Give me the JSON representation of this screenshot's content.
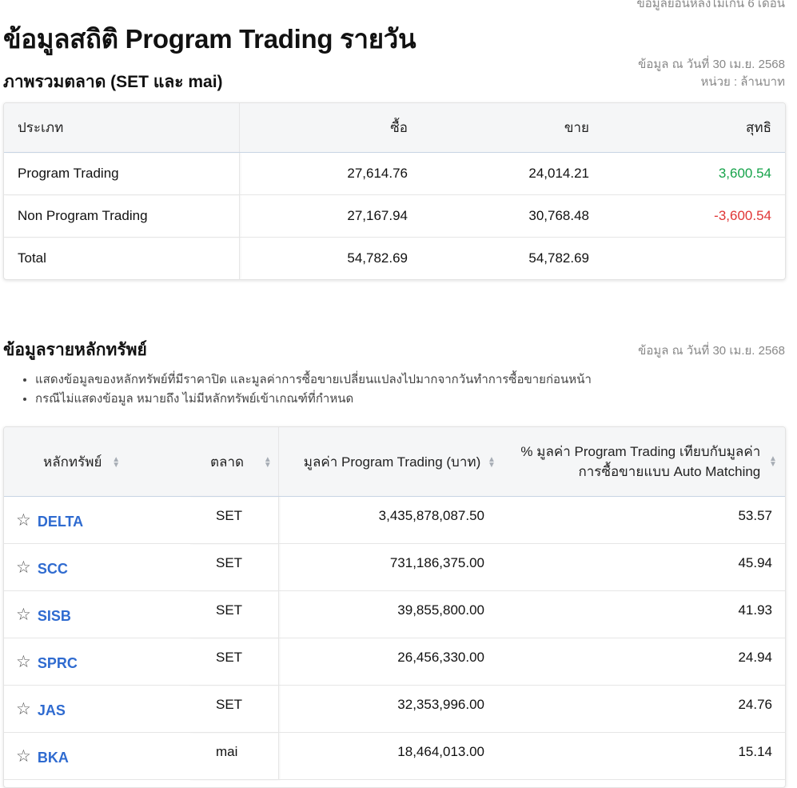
{
  "top_note": "ข้อมูลย้อนหลังไม่เกิน 6 เดือน",
  "page_title": "ข้อมูลสถิติ Program Trading รายวัน",
  "overview": {
    "title": "ภาพรวมตลาด (SET และ mai)",
    "date_label": "ข้อมูล ณ วันที่ 30 เม.ย. 2568",
    "unit_label": "หน่วย : ล้านบาท",
    "headers": [
      "ประเภท",
      "ซื้อ",
      "ขาย",
      "สุทธิ"
    ],
    "rows": [
      {
        "type": "Program Trading",
        "buy": "27,614.76",
        "sell": "24,014.21",
        "net": "3,600.54"
      },
      {
        "type": "Non Program Trading",
        "buy": "27,167.94",
        "sell": "30,768.48",
        "net": "-3,600.54"
      },
      {
        "type": "Total",
        "buy": "54,782.69",
        "sell": "54,782.69",
        "net": ""
      }
    ],
    "colors": {
      "positive": "#16a34a",
      "negative": "#e03535"
    }
  },
  "securities": {
    "title": "ข้อมูลรายหลักทรัพย์",
    "date_label": "ข้อมูล ณ วันที่ 30 เม.ย. 2568",
    "notes": [
      "แสดงข้อมูลของหลักทรัพย์ที่มีราคาปิด และมูลค่าการซื้อขายเปลี่ยนแปลงไปมากจากวันทำการซื้อขายก่อนหน้า",
      "กรณีไม่แสดงข้อมูล หมายถึง ไม่มีหลักทรัพย์เข้าเกณฑ์ที่กำหนด"
    ],
    "headers": {
      "symbol": "หลักทรัพย์",
      "market": "ตลาด",
      "value": "มูลค่า Program Trading (บาท)",
      "pct_line1": "% มูลค่า Program Trading เทียบกับมูลค่า",
      "pct_line2": "การซื้อขายแบบ Auto Matching"
    },
    "rows": [
      {
        "symbol": "DELTA",
        "market": "SET",
        "value": "3,435,878,087.50",
        "pct": "53.57"
      },
      {
        "symbol": "SCC",
        "market": "SET",
        "value": "731,186,375.00",
        "pct": "45.94"
      },
      {
        "symbol": "SISB",
        "market": "SET",
        "value": "39,855,800.00",
        "pct": "41.93"
      },
      {
        "symbol": "SPRC",
        "market": "SET",
        "value": "26,456,330.00",
        "pct": "24.94"
      },
      {
        "symbol": "JAS",
        "market": "SET",
        "value": "32,353,996.00",
        "pct": "24.76"
      },
      {
        "symbol": "BKA",
        "market": "mai",
        "value": "18,464,013.00",
        "pct": "15.14"
      }
    ],
    "link_color": "#2f6bd0"
  }
}
